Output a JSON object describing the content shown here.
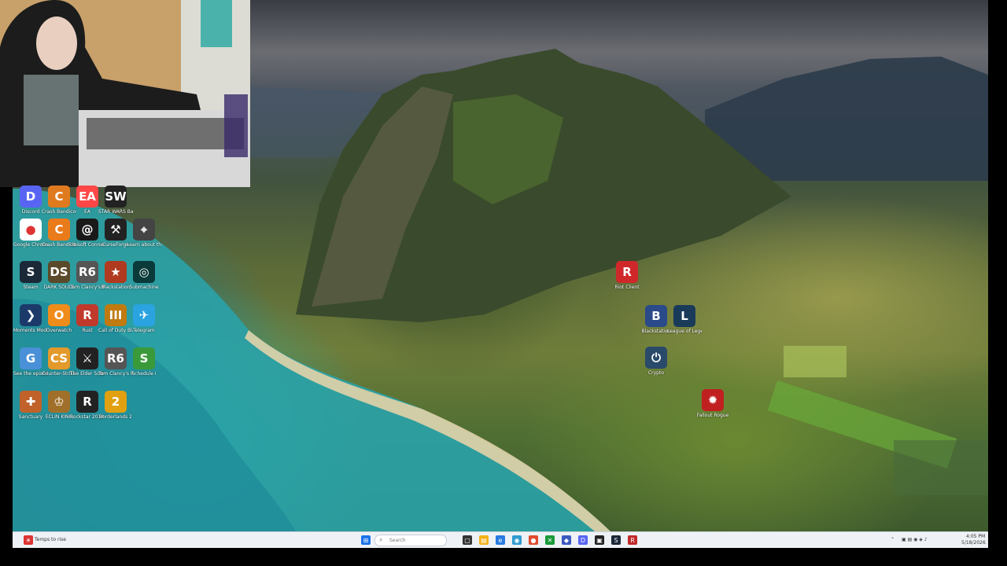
{
  "desktop_icons": [
    {
      "label": "Discord",
      "color": "#5865f2",
      "glyph": "D",
      "icon": "discord-icon"
    },
    {
      "label": "Crash Bandicoot",
      "color": "#e07a1f",
      "glyph": "C",
      "icon": "crash-icon"
    },
    {
      "label": "EA",
      "color": "#ff4747",
      "glyph": "EA",
      "icon": "ea-icon"
    },
    {
      "label": "STAR WARS Battlefront",
      "color": "#222",
      "glyph": "SW",
      "icon": "starwars-icon"
    },
    {
      "label": "Google Chrome",
      "color": "#ffffff",
      "glyph": "●",
      "icon": "chrome-icon"
    },
    {
      "label": "Crash Bandicoot",
      "color": "#e97b1a",
      "glyph": "C",
      "icon": "crash-icon"
    },
    {
      "label": "Ubisoft Connect",
      "color": "#1a1a1a",
      "glyph": "@",
      "icon": "ubisoft-icon"
    },
    {
      "label": "CurseForge",
      "color": "#222",
      "glyph": "⚒",
      "icon": "curseforge-icon"
    },
    {
      "label": "Learn about this picture",
      "color": "#444",
      "glyph": "⌖",
      "icon": "learn-picture-icon"
    },
    {
      "label": "Steam",
      "color": "#1b2838",
      "glyph": "S",
      "icon": "steam-icon"
    },
    {
      "label": "DARK SOULS",
      "color": "#5a4a2a",
      "glyph": "DS",
      "icon": "darksouls-icon"
    },
    {
      "label": "Tom Clancy's Rainbow Six",
      "color": "#555",
      "glyph": "R6",
      "icon": "rainbow-six-icon"
    },
    {
      "label": "Blackstation",
      "color": "#b03a1f",
      "glyph": "★",
      "icon": "blackstation-icon"
    },
    {
      "label": "Submachine",
      "color": "#0a3a3a",
      "glyph": "◎",
      "icon": "submachine-icon"
    },
    {
      "label": "Moments Mod Playlist",
      "color": "#1b3a6a",
      "glyph": "❯",
      "icon": "moments-icon"
    },
    {
      "label": "Overwatch",
      "color": "#f08c1a",
      "glyph": "O",
      "icon": "overwatch-icon"
    },
    {
      "label": "Rust",
      "color": "#c0392b",
      "glyph": "R",
      "icon": "rust-icon"
    },
    {
      "label": "Call of Duty Black Ops III",
      "color": "#c07a10",
      "glyph": "III",
      "icon": "cod-icon"
    },
    {
      "label": "Telegram",
      "color": "#2aa3e0",
      "glyph": "✈",
      "icon": "telegram-icon"
    },
    {
      "label": "See the episode",
      "color": "#4a90d9",
      "glyph": "G",
      "icon": "see-episode-icon"
    },
    {
      "label": "Counter-Strike",
      "color": "#e39a2a",
      "glyph": "CS",
      "icon": "counter-strike-icon"
    },
    {
      "label": "The Elder Scrolls",
      "color": "#222",
      "glyph": "⚔",
      "icon": "elder-scrolls-icon"
    },
    {
      "label": "Tom Clancy's Rainbow Six",
      "color": "#555",
      "glyph": "R6",
      "icon": "rainbow-six-icon"
    },
    {
      "label": "Schedule I",
      "color": "#3a9a3a",
      "glyph": "S",
      "icon": "schedule-icon"
    },
    {
      "label": "Sanctuary",
      "color": "#c0622a",
      "glyph": "✚",
      "icon": "sanctuary-icon"
    },
    {
      "label": "ECLIN KING",
      "color": "#a0702a",
      "glyph": "♔",
      "icon": "eclin-king-icon"
    },
    {
      "label": "Rockstar 2014 Edition",
      "color": "#222",
      "glyph": "R",
      "icon": "rockstar-icon"
    },
    {
      "label": "Borderlands 2",
      "color": "#e0a010",
      "glyph": "2",
      "icon": "borderlands-icon"
    }
  ],
  "scattered_icons": [
    {
      "label": "Riot Client",
      "color": "#d0282a",
      "glyph": "R",
      "icon": "riot-client-icon"
    },
    {
      "label": "Blackstation",
      "color": "#2a4a8a",
      "glyph": "B",
      "icon": "blackstation-icon"
    },
    {
      "label": "League of Legends",
      "color": "#1a3a5a",
      "glyph": "L",
      "icon": "league-icon"
    },
    {
      "label": "Crypto",
      "color": "#2a4a6a",
      "glyph": "⏻",
      "icon": "power-icon"
    },
    {
      "label": "Fallout Rogue",
      "color": "#c02020",
      "glyph": "✹",
      "icon": "fallout-icon"
    }
  ],
  "taskbar": {
    "weather": "Temps to rise",
    "search_placeholder": "Search",
    "time": "4:05 PM",
    "date": "5/18/2026"
  }
}
